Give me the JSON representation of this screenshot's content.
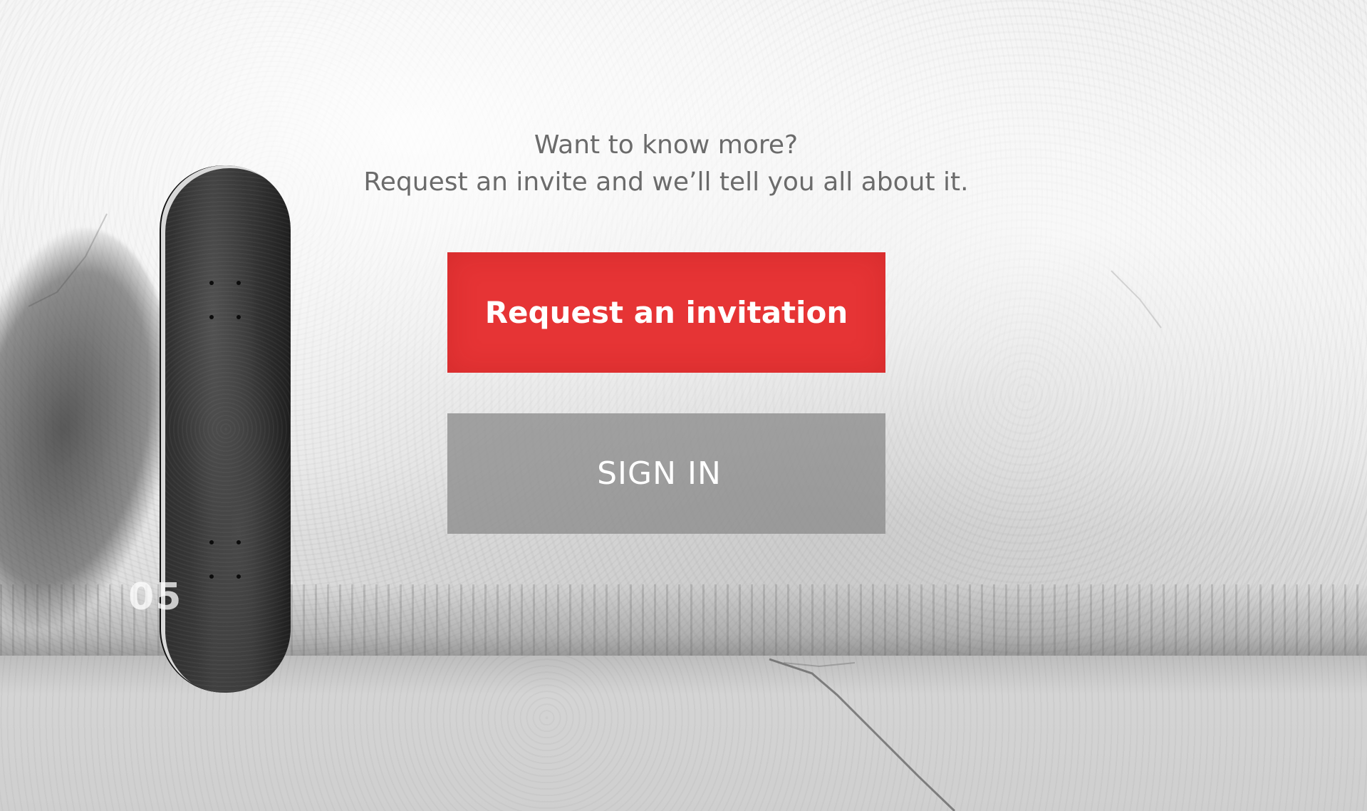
{
  "intro": {
    "line1": "Want to know more?",
    "line2": "Request an invite and we’ll tell you all about it."
  },
  "actions": {
    "request_label": "Request an invitation",
    "signin_label": "SIGN IN"
  },
  "background": {
    "floor_marking": "05"
  },
  "colors": {
    "primary_button": "#e63435",
    "secondary_button": "#8c8c8c",
    "intro_text": "#6b6b6b"
  }
}
